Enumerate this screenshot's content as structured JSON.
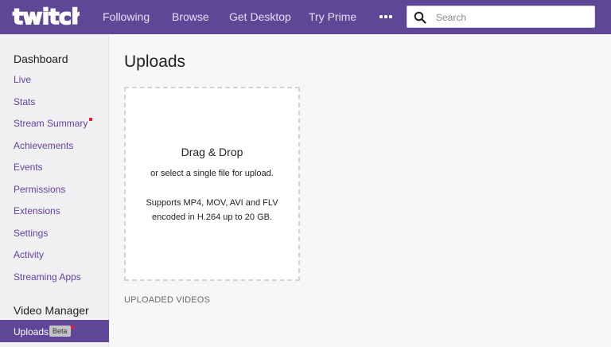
{
  "header": {
    "logo_text": "twitch",
    "nav": [
      "Following",
      "Browse",
      "Get Desktop",
      "Try Prime"
    ],
    "more_icon": "more-horizontal-icon",
    "search": {
      "placeholder": "Search",
      "icon": "search-icon"
    },
    "colors": {
      "bar": "#5e4796",
      "nav_text": "#e6dff5"
    }
  },
  "sidebar": {
    "dashboard_heading": "Dashboard",
    "dashboard_items": [
      "Live",
      "Stats",
      "Stream Summary",
      "Achievements",
      "Events",
      "Permissions",
      "Extensions",
      "Settings",
      "Activity",
      "Streaming Apps"
    ],
    "video_heading": "Video Manager",
    "active_item": {
      "label": "Uploads",
      "badge": "Beta"
    },
    "colors": {
      "link": "#6441a5",
      "active_bg": "#5e4796",
      "notification": "#e0202a"
    }
  },
  "main": {
    "title": "Uploads",
    "dropzone": {
      "title": "Drag & Drop",
      "subtitle": "or select a single file for upload.",
      "support_line1": "Supports MP4, MOV, AVI and FLV",
      "support_line2": "encoded in H.264 up to 20 GB."
    },
    "uploaded_label": "UPLOADED VIDEOS"
  }
}
